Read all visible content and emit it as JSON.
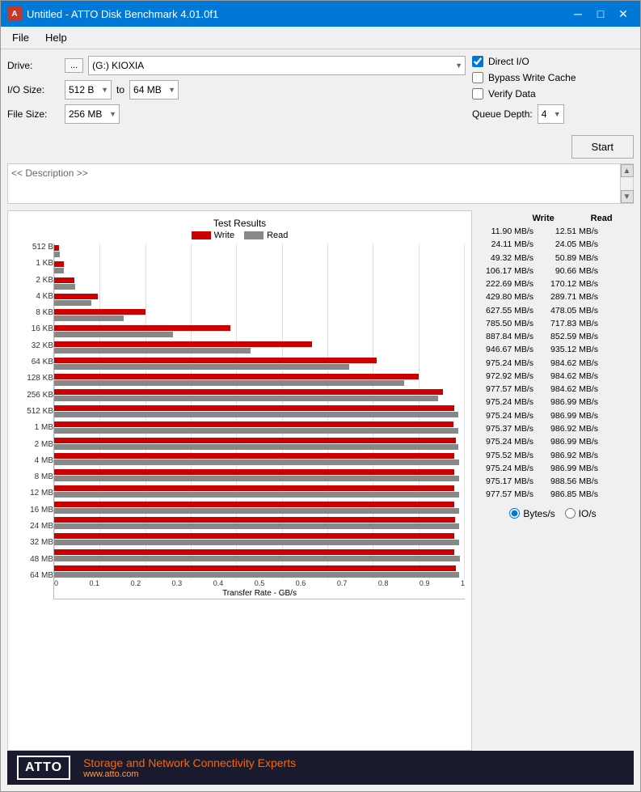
{
  "window": {
    "title": "Untitled - ATTO Disk Benchmark 4.01.0f1",
    "icon": "A"
  },
  "titlebar": {
    "minimize": "─",
    "maximize": "□",
    "close": "✕"
  },
  "menu": {
    "items": [
      "File",
      "Help"
    ]
  },
  "controls": {
    "drive_label": "Drive:",
    "drive_browse": "...",
    "drive_value": "(G:) KIOXIA",
    "io_size_label": "I/O Size:",
    "io_size_from": "512 B",
    "io_size_to": "to",
    "io_size_end": "64 MB",
    "file_size_label": "File Size:",
    "file_size_value": "256 MB",
    "description_text": "<< Description >>",
    "direct_io_label": "Direct I/O",
    "direct_io_checked": true,
    "bypass_write_cache_label": "Bypass Write Cache",
    "bypass_write_cache_checked": false,
    "verify_data_label": "Verify Data",
    "verify_data_checked": false,
    "queue_depth_label": "Queue Depth:",
    "queue_depth_value": "4",
    "start_label": "Start"
  },
  "chart": {
    "title": "Test Results",
    "legend_write": "Write",
    "legend_read": "Read",
    "x_axis_label": "Transfer Rate - GB/s",
    "x_ticks": [
      "0",
      "0.1",
      "0.2",
      "0.3",
      "0.4",
      "0.5",
      "0.6",
      "0.7",
      "0.8",
      "0.9",
      "1"
    ],
    "y_labels": [
      "512 B",
      "1 KB",
      "2 KB",
      "4 KB",
      "8 KB",
      "16 KB",
      "32 KB",
      "64 KB",
      "128 KB",
      "256 KB",
      "512 KB",
      "1 MB",
      "2 MB",
      "4 MB",
      "8 MB",
      "12 MB",
      "16 MB",
      "24 MB",
      "32 MB",
      "48 MB",
      "64 MB"
    ],
    "bars": [
      {
        "write": 1.2,
        "read": 1.3
      },
      {
        "write": 2.4,
        "read": 2.4
      },
      {
        "write": 4.9,
        "read": 5.1
      },
      {
        "write": 10.6,
        "read": 9.1
      },
      {
        "write": 22.3,
        "read": 17.0
      },
      {
        "write": 43.0,
        "read": 29.0
      },
      {
        "write": 62.8,
        "read": 47.8
      },
      {
        "write": 78.6,
        "read": 71.8
      },
      {
        "write": 88.8,
        "read": 85.3
      },
      {
        "write": 94.7,
        "read": 93.5
      },
      {
        "write": 97.5,
        "read": 98.5
      },
      {
        "write": 97.3,
        "read": 98.5
      },
      {
        "write": 97.8,
        "read": 98.5
      },
      {
        "write": 97.5,
        "read": 98.7
      },
      {
        "write": 97.5,
        "read": 98.7
      },
      {
        "write": 97.5,
        "read": 98.7
      },
      {
        "write": 97.5,
        "read": 98.7
      },
      {
        "write": 97.6,
        "read": 98.7
      },
      {
        "write": 97.5,
        "read": 98.7
      },
      {
        "write": 97.5,
        "read": 98.9
      },
      {
        "write": 97.8,
        "read": 98.7
      }
    ]
  },
  "results": {
    "write_header": "Write",
    "read_header": "Read",
    "rows": [
      {
        "size": "512 B",
        "write": "11.90 MB/s",
        "read": "12.51 MB/s"
      },
      {
        "size": "1 KB",
        "write": "24.11 MB/s",
        "read": "24.05 MB/s"
      },
      {
        "size": "2 KB",
        "write": "49.32 MB/s",
        "read": "50.89 MB/s"
      },
      {
        "size": "4 KB",
        "write": "106.17 MB/s",
        "read": "90.66 MB/s"
      },
      {
        "size": "8 KB",
        "write": "222.69 MB/s",
        "read": "170.12 MB/s"
      },
      {
        "size": "16 KB",
        "write": "429.80 MB/s",
        "read": "289.71 MB/s"
      },
      {
        "size": "32 KB",
        "write": "627.55 MB/s",
        "read": "478.05 MB/s"
      },
      {
        "size": "64 KB",
        "write": "785.50 MB/s",
        "read": "717.83 MB/s"
      },
      {
        "size": "128 KB",
        "write": "887.84 MB/s",
        "read": "852.59 MB/s"
      },
      {
        "size": "256 KB",
        "write": "946.67 MB/s",
        "read": "935.12 MB/s"
      },
      {
        "size": "512 KB",
        "write": "975.24 MB/s",
        "read": "984.62 MB/s"
      },
      {
        "size": "1 MB",
        "write": "972.92 MB/s",
        "read": "984.62 MB/s"
      },
      {
        "size": "2 MB",
        "write": "977.57 MB/s",
        "read": "984.62 MB/s"
      },
      {
        "size": "4 MB",
        "write": "975.24 MB/s",
        "read": "986.99 MB/s"
      },
      {
        "size": "8 MB",
        "write": "975.24 MB/s",
        "read": "986.99 MB/s"
      },
      {
        "size": "12 MB",
        "write": "975.37 MB/s",
        "read": "986.92 MB/s"
      },
      {
        "size": "16 MB",
        "write": "975.24 MB/s",
        "read": "986.99 MB/s"
      },
      {
        "size": "24 MB",
        "write": "975.52 MB/s",
        "read": "986.92 MB/s"
      },
      {
        "size": "32 MB",
        "write": "975.24 MB/s",
        "read": "986.99 MB/s"
      },
      {
        "size": "48 MB",
        "write": "975.17 MB/s",
        "read": "988.56 MB/s"
      },
      {
        "size": "64 MB",
        "write": "977.57 MB/s",
        "read": "986.85 MB/s"
      }
    ],
    "unit_bytes": "Bytes/s",
    "unit_io": "IO/s",
    "unit_bytes_selected": true
  },
  "footer": {
    "logo": "ATTO",
    "tagline": "Storage and Network Connectivity Experts",
    "url": "www.atto.com"
  }
}
